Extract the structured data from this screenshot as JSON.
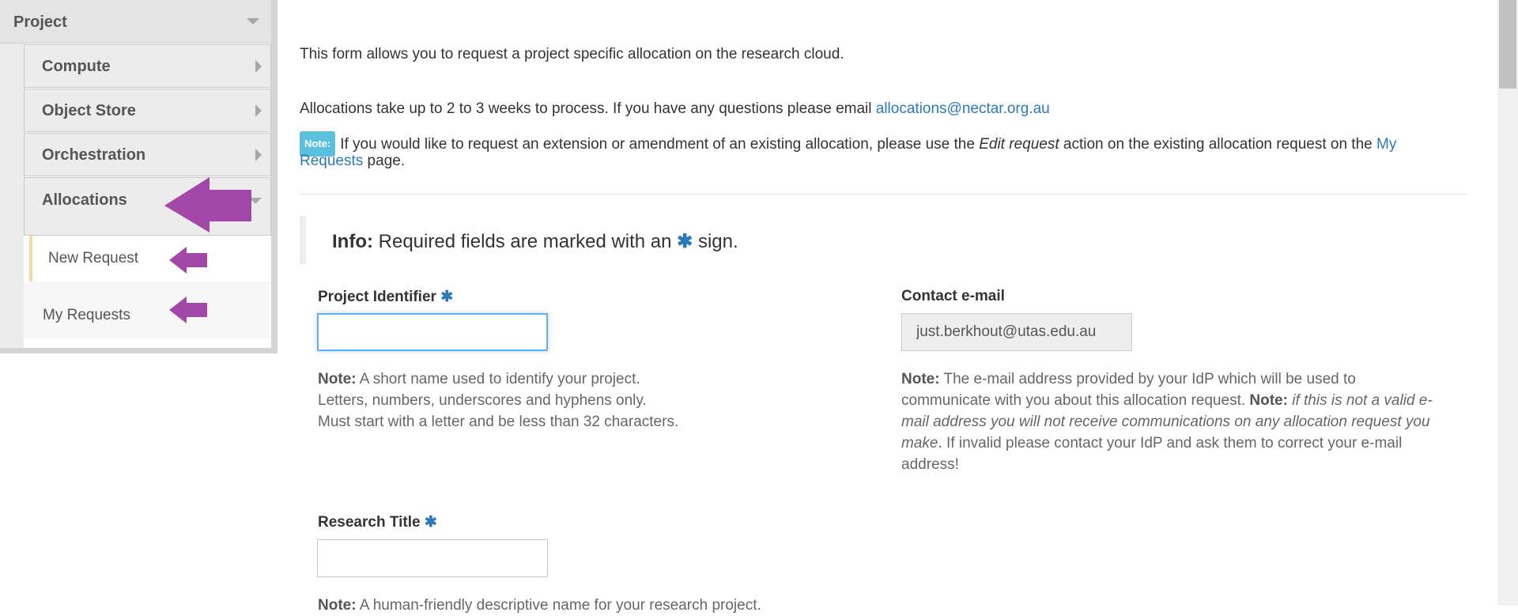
{
  "sidebar": {
    "project_label": "Project",
    "items": [
      {
        "label": "Compute"
      },
      {
        "label": "Object Store"
      },
      {
        "label": "Orchestration"
      },
      {
        "label": "Allocations"
      }
    ],
    "leaves": [
      {
        "label": "New Request",
        "active": true
      },
      {
        "label": "My Requests",
        "active": false
      }
    ],
    "arrow_color": "#a347a8",
    "active_marker_color": "#f2dca0"
  },
  "main": {
    "intro": "This form allows you to request a project specific allocation on the research cloud.",
    "process_text": "Allocations take up to 2 to 3 weeks to process. If you have any questions please email ",
    "process_email": "allocations@nectar.org.au",
    "note_badge": "Note:",
    "note_text_1": "If you would like to request an extension or amendment of an existing allocation, please use the ",
    "note_em": "Edit request",
    "note_text_2": " action on the existing allocation request on the ",
    "note_link_1": "My",
    "note_link_2": "Requests",
    "note_text_3": " page.",
    "info_label": "Info:",
    "info_text_1": " Required fields are marked with an ",
    "info_text_2": " sign.",
    "required_glyph": "✱",
    "link_color": "#2a7ab8"
  },
  "form": {
    "project_identifier": {
      "label": "Project Identifier",
      "value": "",
      "note_label": "Note:",
      "note_lines": [
        " A short name used to identify your project.",
        "Letters, numbers, underscores and hyphens only.",
        "Must start with a letter and be less than 32 characters."
      ]
    },
    "contact_email": {
      "label": "Contact e-mail",
      "value": "just.berkhout@utas.edu.au",
      "note_label": "Note:",
      "note_line_1": " The e-mail address provided by your IdP which will be used to",
      "note_line_2a": "communicate with you about this allocation request. ",
      "note_line_2b": "Note:",
      "note_line_2c": " if this is not a valid e-",
      "note_line_3": "mail address you will not receive communications on any allocation request you",
      "note_line_4a": "make",
      "note_line_4b": ". If invalid please contact your IdP and ask them to correct your e-mail",
      "note_line_5": "address!"
    },
    "research_title": {
      "label": "Research Title",
      "value": "",
      "note_label": "Note:",
      "note_text": " A human-friendly descriptive name for your research project."
    }
  }
}
